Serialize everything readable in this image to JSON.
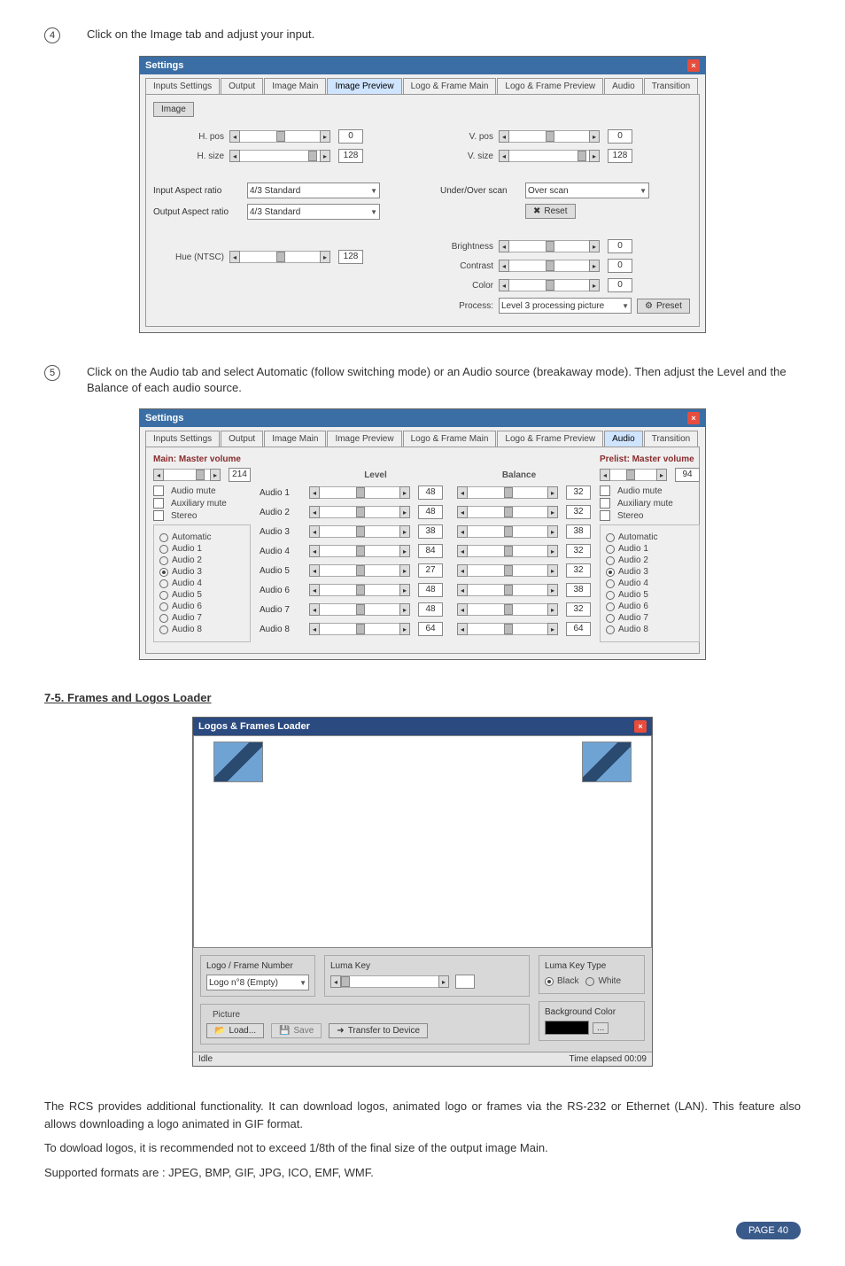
{
  "step4": {
    "number": "4",
    "text": "Click on the Image tab and adjust your input."
  },
  "step5": {
    "number": "5",
    "text": "Click on the Audio tab and select Automatic (follow switching mode) or an Audio source (breakaway mode). Then adjust the Level and the Balance of each audio source."
  },
  "dlg1": {
    "title": "Settings",
    "tabs": [
      "Inputs Settings",
      "Output",
      "Image Main",
      "Image Preview",
      "Logo & Frame Main",
      "Logo & Frame Preview",
      "Audio",
      "Transition"
    ],
    "active_tab_idx": 3,
    "sub_btn": "Image",
    "hpos": {
      "label": "H. pos",
      "val": "0"
    },
    "hsize": {
      "label": "H. size",
      "val": "128"
    },
    "vpos": {
      "label": "V. pos",
      "val": "0"
    },
    "vsize": {
      "label": "V. size",
      "val": "128"
    },
    "in_aspect": {
      "label": "Input Aspect ratio",
      "val": "4/3  Standard"
    },
    "out_aspect": {
      "label": "Output Aspect ratio",
      "val": "4/3  Standard"
    },
    "under_over": {
      "label": "Under/Over scan",
      "val": "Over  scan"
    },
    "reset_btn": "Reset",
    "hue": {
      "label": "Hue (NTSC)",
      "val": "128"
    },
    "brightness": {
      "label": "Brightness",
      "val": "0"
    },
    "contrast": {
      "label": "Contrast",
      "val": "0"
    },
    "color": {
      "label": "Color",
      "val": "0"
    },
    "process": {
      "label": "Process:",
      "val": "Level 3 processing picture"
    },
    "preset_btn": "Preset"
  },
  "dlg2": {
    "title": "Settings",
    "tabs": [
      "Inputs Settings",
      "Output",
      "Image Main",
      "Image Preview",
      "Logo & Frame Main",
      "Logo & Frame Preview",
      "Audio",
      "Transition"
    ],
    "active_tab_idx": 6,
    "main_vol": {
      "label": "Main: Master volume",
      "val": "214"
    },
    "prelist_vol": {
      "label": "Prelist: Master volume",
      "val": "94"
    },
    "audio_mute": "Audio mute",
    "aux_mute": "Auxiliary mute",
    "stereo": "Stereo",
    "level_hdr": "Level",
    "balance_hdr": "Balance",
    "rows": [
      {
        "name": "Audio 1",
        "level": "48",
        "balance": "32"
      },
      {
        "name": "Audio 2",
        "level": "48",
        "balance": "32"
      },
      {
        "name": "Audio 3",
        "level": "38",
        "balance": "38"
      },
      {
        "name": "Audio 4",
        "level": "84",
        "balance": "32"
      },
      {
        "name": "Audio 5",
        "level": "27",
        "balance": "32"
      },
      {
        "name": "Audio 6",
        "level": "48",
        "balance": "38"
      },
      {
        "name": "Audio 7",
        "level": "48",
        "balance": "32"
      },
      {
        "name": "Audio 8",
        "level": "64",
        "balance": "64"
      }
    ],
    "radios_left": [
      "Automatic",
      "Audio 1",
      "Audio 2",
      "Audio 3",
      "Audio 4",
      "Audio 5",
      "Audio 6",
      "Audio 7",
      "Audio 8"
    ],
    "radios_left_sel": 3,
    "radios_right": [
      "Automatic",
      "Audio 1",
      "Audio 2",
      "Audio 3",
      "Audio 4",
      "Audio 5",
      "Audio 6",
      "Audio 7",
      "Audio 8"
    ],
    "radios_right_sel": 3
  },
  "section75": "7-5. Frames and Logos Loader",
  "dlg3": {
    "title": "Logos & Frames Loader",
    "logo_frame_num": {
      "label": "Logo / Frame Number",
      "val": "Logo n°8 (Empty)"
    },
    "luma_key": "Luma Key",
    "luma_key_type": {
      "label": "Luma Key Type",
      "black": "Black",
      "white": "White"
    },
    "picture_group": "Picture",
    "load_btn": "Load...",
    "save_btn": "Save",
    "transfer_btn": "Transfer to Device",
    "bg_color": "Background Color",
    "status_left": "Idle",
    "status_right": "Time elapsed  00:09"
  },
  "para1": "The RCS provides additional functionality. It can download logos, animated logo or frames via the RS-232 or Ethernet (LAN). This feature also allows downloading a logo animated in GIF format.",
  "para2": "To dowload logos, it is recommended not to exceed 1/8th of the final size of the output image Main.",
  "para3": "Supported formats are : JPEG, BMP, GIF, JPG, ICO, EMF, WMF.",
  "page": "PAGE 40"
}
